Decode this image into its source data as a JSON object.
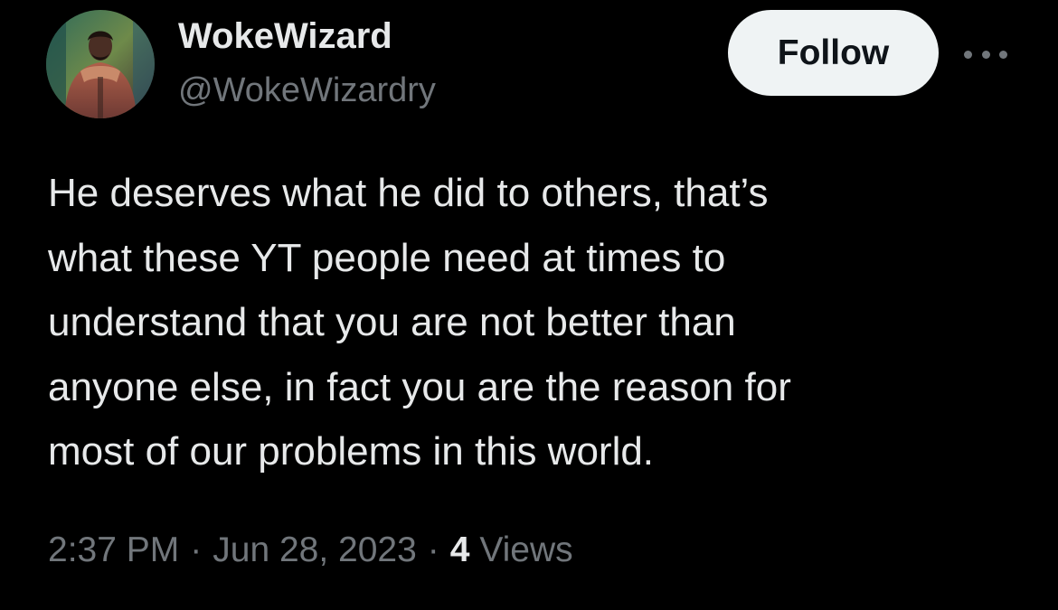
{
  "author": {
    "display_name": "WokeWizard",
    "handle": "@WokeWizardry",
    "avatar_icon": "profile-photo"
  },
  "actions": {
    "follow_label": "Follow",
    "more_icon": "more-horizontal-icon"
  },
  "tweet": {
    "lines": [
      "He deserves what he did to others, that’s",
      "what these YT people need at times to",
      "understand that you are not better than",
      "anyone else, in fact you are the reason for",
      "most of our problems in this world."
    ]
  },
  "meta": {
    "time": "2:37 PM",
    "separator": "·",
    "date": "Jun 28, 2023",
    "view_count": "4",
    "views_label": "Views"
  },
  "colors": {
    "background": "#000000",
    "primary_text": "#e7e9ea",
    "secondary_text": "#71767b",
    "follow_button_bg": "#eff3f4",
    "follow_button_text": "#0f1419"
  }
}
